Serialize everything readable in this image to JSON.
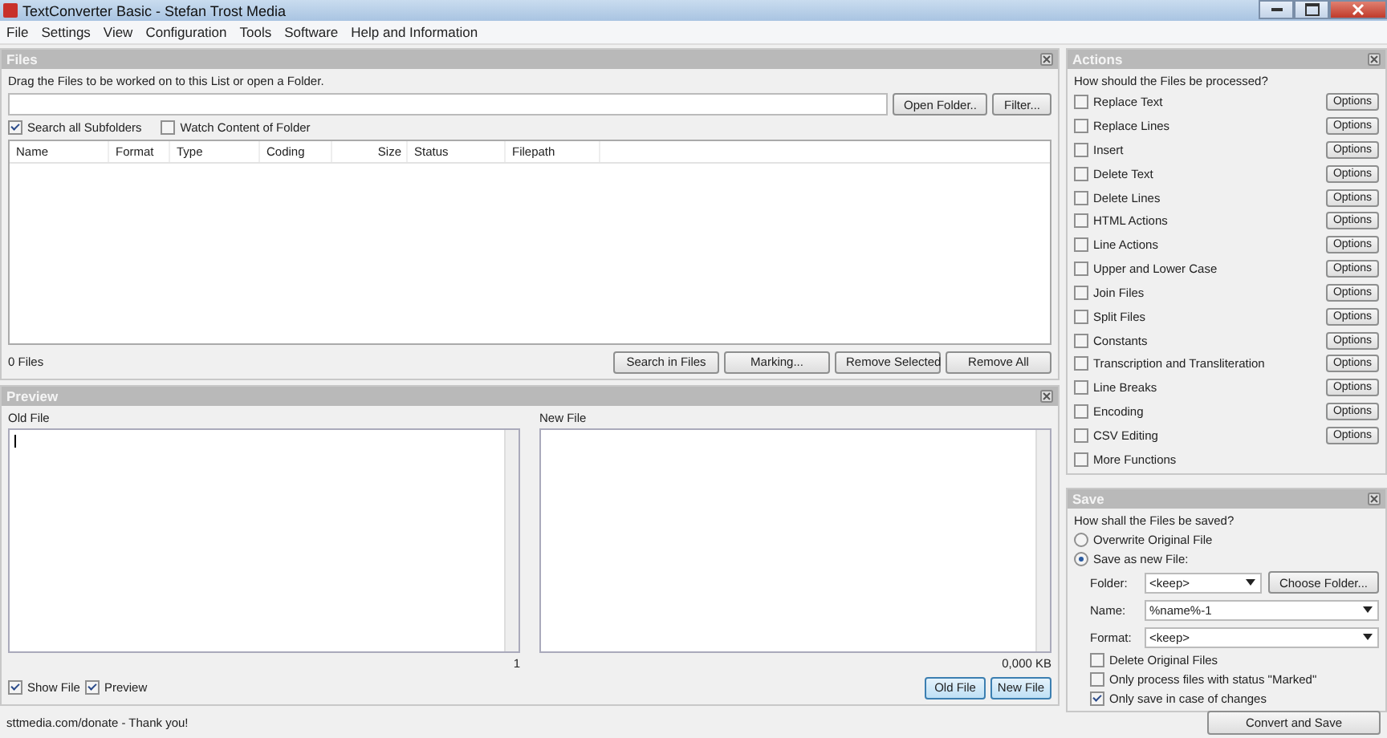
{
  "window": {
    "title": "TextConverter Basic - Stefan Trost Media"
  },
  "menu": [
    "File",
    "Settings",
    "View",
    "Configuration",
    "Tools",
    "Software",
    "Help and Information"
  ],
  "files": {
    "title": "Files",
    "hint": "Drag the Files to be worked on to this List or open a Folder.",
    "path_buttons": [
      "Open Folder..",
      "Filter..."
    ],
    "options": [
      {
        "label": "Search all Subfolders",
        "checked": true
      },
      {
        "label": "Watch Content of Folder",
        "checked": false
      }
    ],
    "columns": [
      "Name",
      "Format",
      "Type",
      "Coding",
      "Size",
      "Status",
      "Filepath"
    ],
    "count": "0 Files",
    "buttons": [
      "Search in Files",
      "Marking...",
      "Remove Selected",
      "Remove All"
    ]
  },
  "preview": {
    "title": "Preview",
    "old_label": "Old File",
    "new_label": "New File",
    "line": "1",
    "size": "0,000 KB",
    "options": [
      {
        "label": "Show File",
        "checked": true
      },
      {
        "label": "Preview",
        "checked": true
      }
    ],
    "buttons": [
      "Old File",
      "New File"
    ]
  },
  "actions": {
    "title": "Actions",
    "question": "How should the Files be processed?",
    "items": [
      {
        "label": "Replace Text",
        "checked": false,
        "button": "Options"
      },
      {
        "label": "Replace Lines",
        "checked": false,
        "button": "Options"
      },
      {
        "label": "Insert",
        "checked": false,
        "button": "Options"
      },
      {
        "label": "Delete Text",
        "checked": false,
        "button": "Options"
      },
      {
        "label": "Delete Lines",
        "checked": false,
        "button": "Options"
      },
      {
        "label": "HTML Actions",
        "checked": false,
        "button": "Options"
      },
      {
        "label": "Line Actions",
        "checked": false,
        "button": "Options"
      },
      {
        "label": "Upper and Lower Case",
        "checked": false,
        "button": "Options"
      },
      {
        "label": "Join Files",
        "checked": false,
        "button": "Options"
      },
      {
        "label": "Split Files",
        "checked": false,
        "button": "Options"
      },
      {
        "label": "Constants",
        "checked": false,
        "button": "Options"
      },
      {
        "label": "Transcription and Transliteration",
        "checked": false,
        "button": "Options"
      },
      {
        "label": "Line Breaks",
        "checked": false,
        "button": "Options"
      },
      {
        "label": "Encoding",
        "checked": false,
        "button": "Options"
      },
      {
        "label": "CSV Editing",
        "checked": false,
        "button": "Options"
      },
      {
        "label": "More Functions",
        "checked": false
      }
    ]
  },
  "save": {
    "title": "Save",
    "question": "How shall the Files be saved?",
    "modes": [
      {
        "label": "Overwrite Original File",
        "selected": false
      },
      {
        "label": "Save as new File:",
        "selected": true
      }
    ],
    "fields": [
      {
        "label": "Folder:",
        "value": "<keep>",
        "button": "Choose Folder..."
      },
      {
        "label": "Name:",
        "value": "%name%-1"
      },
      {
        "label": "Format:",
        "value": "<keep>"
      }
    ],
    "options": [
      {
        "label": "Delete Original Files",
        "checked": false
      },
      {
        "label": "Only process files with status \"Marked\"",
        "checked": false
      },
      {
        "label": "Only save in case of changes",
        "checked": true
      }
    ]
  },
  "status_bar": {
    "text": "sttmedia.com/donate - Thank you!",
    "button": "Convert and Save"
  }
}
